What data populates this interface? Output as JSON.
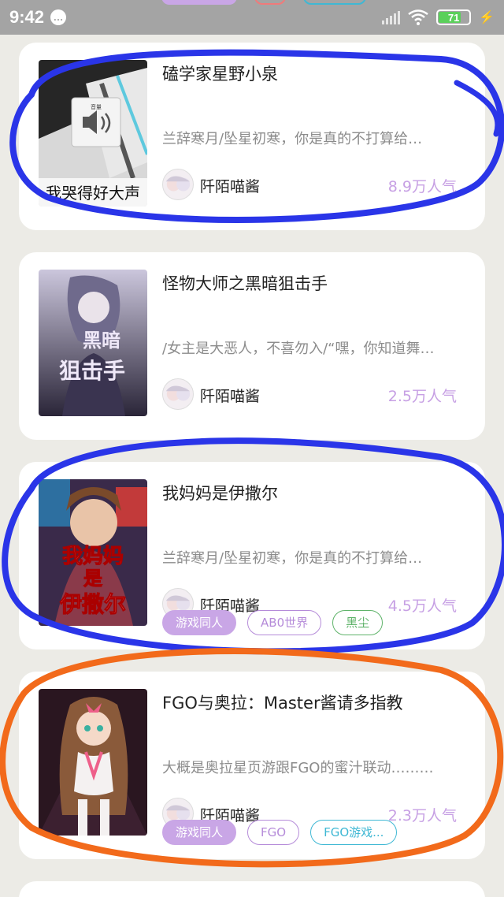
{
  "status_bar": {
    "time": "9:42",
    "battery": "71"
  },
  "colors": {
    "background": "#ecebe6",
    "popularity": "#c7a0e4",
    "tag_purple": "#c9a6e6",
    "tag_green": "#5fb36a",
    "tag_cyan": "#3fb8d4",
    "mark_blue": "#2a35e8",
    "mark_orange": "#f26a1b"
  },
  "icons": [
    "chat-bubble-icon",
    "signal-icon",
    "wifi-icon",
    "battery-icon",
    "charge-icon",
    "speaker-icon",
    "author-avatar-icon"
  ],
  "books": [
    {
      "title": "磕学家星野小泉",
      "description": "兰辞寒月/坠星初寒，你是真的不打算给…",
      "author": "阡陌喵酱",
      "popularity": "8.9万人气",
      "cover_caption": "我哭得好大声",
      "cover_badge": "音量",
      "tags": []
    },
    {
      "title": "怪物大师之黑暗狙击手",
      "description": "/女主是大恶人，不喜勿入/“嘿，你知道舞…",
      "author": "阡陌喵酱",
      "popularity": "2.5万人气",
      "cover_caption": "黑暗狙击手",
      "tags": []
    },
    {
      "title": "我妈妈是伊撒尔",
      "description": "兰辞寒月/坠星初寒，你是真的不打算给…",
      "author": "阡陌喵酱",
      "popularity": "4.5万人气",
      "cover_caption": "我妈妈是伊撒尔",
      "tags": [
        "游戏同人",
        "AB0世界",
        "黑尘"
      ]
    },
    {
      "title": "FGO与奥拉：Master酱请多指教",
      "description": "大概是奥拉星页游跟FGO的蜜汁联动………",
      "author": "阡陌喵酱",
      "popularity": "2.3万人气",
      "tags": [
        "游戏同人",
        "FGO",
        "FGO游戏..."
      ]
    }
  ]
}
